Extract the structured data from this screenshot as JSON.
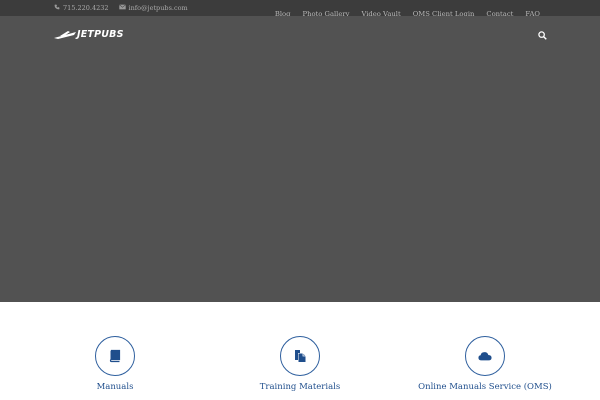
{
  "topbar": {
    "phone": "715.220.4232",
    "email": "info@jetpubs.com"
  },
  "nav": {
    "items": [
      "Blog",
      "Photo Gallery",
      "Video Vault",
      "OMS Client Login",
      "Contact",
      "FAQ"
    ]
  },
  "header": {
    "logo_text": "JETPUBS"
  },
  "features": [
    {
      "label": "Manuals",
      "icon": "book-icon"
    },
    {
      "label": "Training Materials",
      "icon": "documents-icon"
    },
    {
      "label": "Online Manuals Service (OMS)",
      "icon": "cloud-icon"
    }
  ],
  "colors": {
    "topbar": "#3c3c3c",
    "hero": "#525252",
    "accent": "#1f4e8c"
  }
}
